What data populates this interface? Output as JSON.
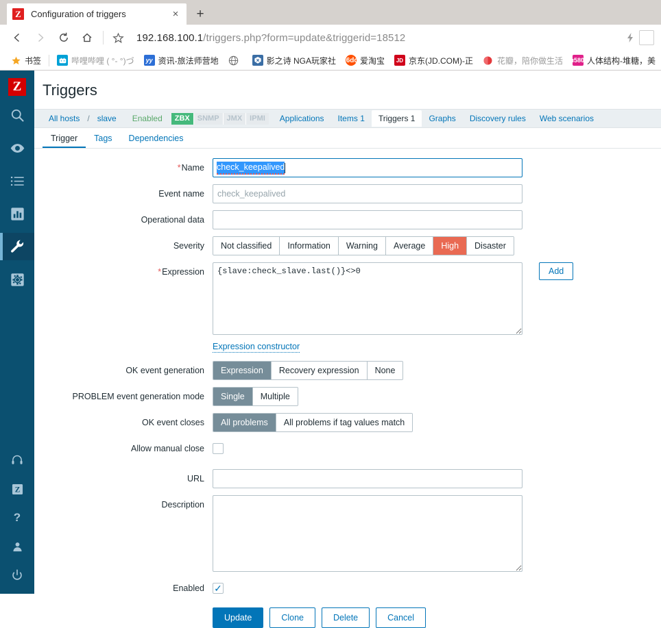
{
  "browser": {
    "tab": {
      "favicon_letter": "Z",
      "title": "Configuration of triggers",
      "close_icon": "×"
    },
    "new_tab_label": "+",
    "nav": {
      "back_icon": "back-arrow",
      "forward_icon": "forward-arrow",
      "reload_icon": "reload",
      "home_icon": "home",
      "star_icon": "star"
    },
    "url": {
      "host": "192.168.100.1",
      "path": "/triggers.php?form=update&triggerid=18512",
      "full": "192.168.100.1/triggers.php?form=update&triggerid=18512"
    },
    "flash_icon": "lightning-bolt-icon",
    "bookmarks": [
      {
        "label": "书签",
        "icon": "star",
        "color": "#f5a623",
        "faded": false
      },
      {
        "label": "哔哩哔哩 ( °- °)づ",
        "icon": "bilibili",
        "color": "#00a1d6",
        "faded": false
      },
      {
        "label": "资讯-旅法师营地",
        "icon": "yyp",
        "color": "#2d6fd6",
        "faded": false
      },
      {
        "label": "",
        "icon": "globe",
        "color": "#ffffff",
        "faded": false
      },
      {
        "label": "影之诗 NGA玩家社",
        "icon": "nga",
        "color": "#3b6ea5",
        "faded": false
      },
      {
        "label": "爱淘宝",
        "icon": "taobao",
        "color": "#ff5000",
        "faded": false
      },
      {
        "label": "京东(JD.COM)-正",
        "icon": "jd",
        "color": "#d0021b",
        "faded": false
      },
      {
        "label": "花瓣，陪你做生活",
        "icon": "huaban",
        "color": "#e4393c",
        "faded": false
      },
      {
        "label": "人体结构-堆糖，美",
        "icon": "duitang",
        "color": "#e0218a",
        "faded": false
      }
    ]
  },
  "sidebar": {
    "logo": "Z",
    "items": [
      {
        "name": "search",
        "icon": "search-icon",
        "active": false
      },
      {
        "name": "monitoring",
        "icon": "eye-icon",
        "active": false
      },
      {
        "name": "inventory",
        "icon": "list-icon",
        "active": false
      },
      {
        "name": "reports",
        "icon": "bar-chart-icon",
        "active": false
      },
      {
        "name": "configuration",
        "icon": "wrench-icon",
        "active": true
      },
      {
        "name": "administration",
        "icon": "cog-square-icon",
        "active": false
      }
    ],
    "bottom_items": [
      {
        "name": "support",
        "icon": "headset-icon"
      },
      {
        "name": "share",
        "icon": "zabbix-z-icon"
      },
      {
        "name": "help",
        "icon": "question-mark-icon"
      },
      {
        "name": "user-settings",
        "icon": "user-icon"
      },
      {
        "name": "sign-out",
        "icon": "power-icon"
      }
    ]
  },
  "page": {
    "title": "Triggers"
  },
  "hostbar": {
    "all_hosts": "All hosts",
    "separator": "/",
    "host": "slave",
    "status": "Enabled",
    "interfaces": [
      {
        "label": "ZBX",
        "active": true
      },
      {
        "label": "SNMP",
        "active": false
      },
      {
        "label": "JMX",
        "active": false
      },
      {
        "label": "IPMI",
        "active": false
      }
    ],
    "tabs": [
      {
        "label": "Applications",
        "selected": false
      },
      {
        "label": "Items 1",
        "selected": false
      },
      {
        "label": "Triggers 1",
        "selected": true
      },
      {
        "label": "Graphs",
        "selected": false
      },
      {
        "label": "Discovery rules",
        "selected": false
      },
      {
        "label": "Web scenarios",
        "selected": false
      }
    ]
  },
  "form_tabs": [
    {
      "label": "Trigger",
      "active": true
    },
    {
      "label": "Tags",
      "active": false
    },
    {
      "label": "Dependencies",
      "active": false
    }
  ],
  "form": {
    "name": {
      "label": "Name",
      "required": true,
      "value": "check_keepalived",
      "selected": true
    },
    "event_name": {
      "label": "Event name",
      "value": "",
      "placeholder": "check_keepalived"
    },
    "operational_data": {
      "label": "Operational data",
      "value": "",
      "placeholder": ""
    },
    "severity": {
      "label": "Severity",
      "options": [
        "Not classified",
        "Information",
        "Warning",
        "Average",
        "High",
        "Disaster"
      ],
      "selected": "High",
      "selected_color": "#e96a53"
    },
    "expression": {
      "label": "Expression",
      "required": true,
      "value": "{slave:check_slave.last()}<>0",
      "add_button": "Add",
      "constructor_link": "Expression constructor"
    },
    "ok_event_generation": {
      "label": "OK event generation",
      "options": [
        "Expression",
        "Recovery expression",
        "None"
      ],
      "selected": "Expression"
    },
    "problem_event_generation_mode": {
      "label": "PROBLEM event generation mode",
      "options": [
        "Single",
        "Multiple"
      ],
      "selected": "Single"
    },
    "ok_event_closes": {
      "label": "OK event closes",
      "options": [
        "All problems",
        "All problems if tag values match"
      ],
      "selected": "All problems"
    },
    "allow_manual_close": {
      "label": "Allow manual close",
      "checked": false
    },
    "url": {
      "label": "URL",
      "value": "",
      "placeholder": ""
    },
    "description": {
      "label": "Description",
      "value": "",
      "placeholder": ""
    },
    "enabled": {
      "label": "Enabled",
      "checked": true,
      "check_glyph": "✓"
    },
    "buttons": [
      {
        "label": "Update",
        "style": "primary"
      },
      {
        "label": "Clone",
        "style": "secondary"
      },
      {
        "label": "Delete",
        "style": "secondary"
      },
      {
        "label": "Cancel",
        "style": "secondary"
      }
    ]
  },
  "colors": {
    "accent": "#0275b8",
    "sidebar": "#0b5070",
    "severity_high": "#e96a53",
    "zbx_green": "#45b97c",
    "segment_selected": "#768d99"
  }
}
